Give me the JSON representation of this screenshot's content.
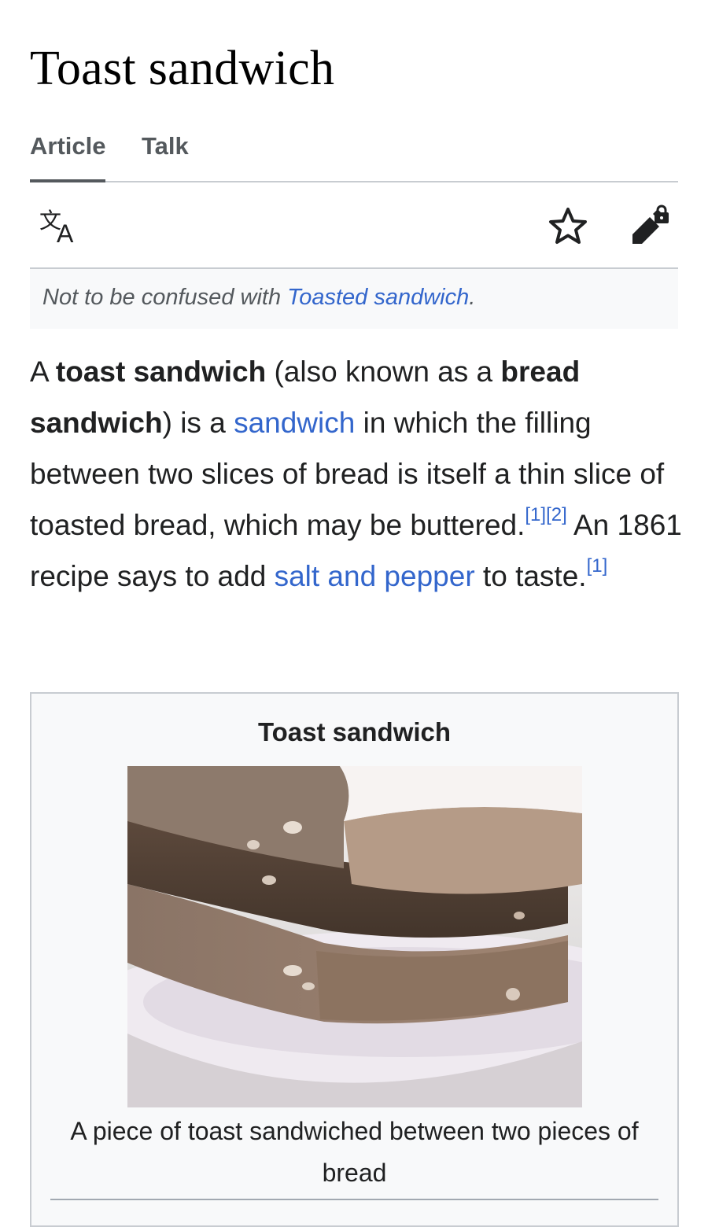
{
  "article": {
    "title": "Toast sandwich"
  },
  "tabs": {
    "article": "Article",
    "talk": "Talk"
  },
  "toolbar": {
    "icons": [
      "language-icon",
      "star-icon",
      "edit-locked-icon"
    ]
  },
  "hatnote": {
    "prefix": "Not to be confused with ",
    "link": "Toasted sandwich",
    "suffix": "."
  },
  "lead": {
    "t1": "A ",
    "b1": "toast sandwich",
    "t2": " (also known as a ",
    "b2": "bread sandwich",
    "t3": ") is a ",
    "link1": "sandwich",
    "t4": " in which the filling between two slices of bread is itself a thin slice of toasted bread, which may be buttered.",
    "ref1": "[1]",
    "ref2": "[2]",
    "t5": " An 1861 recipe says to add ",
    "link2": "salt and pepper",
    "t6": " to taste.",
    "ref3": "[1]"
  },
  "infobox": {
    "title": "Toast sandwich",
    "caption": "A piece of toast sandwiched between two pieces of bread"
  },
  "colors": {
    "link": "#3366cc",
    "text": "#202122",
    "muted": "#54595d",
    "border": "#c8ccd1",
    "panel": "#f8f9fa"
  }
}
